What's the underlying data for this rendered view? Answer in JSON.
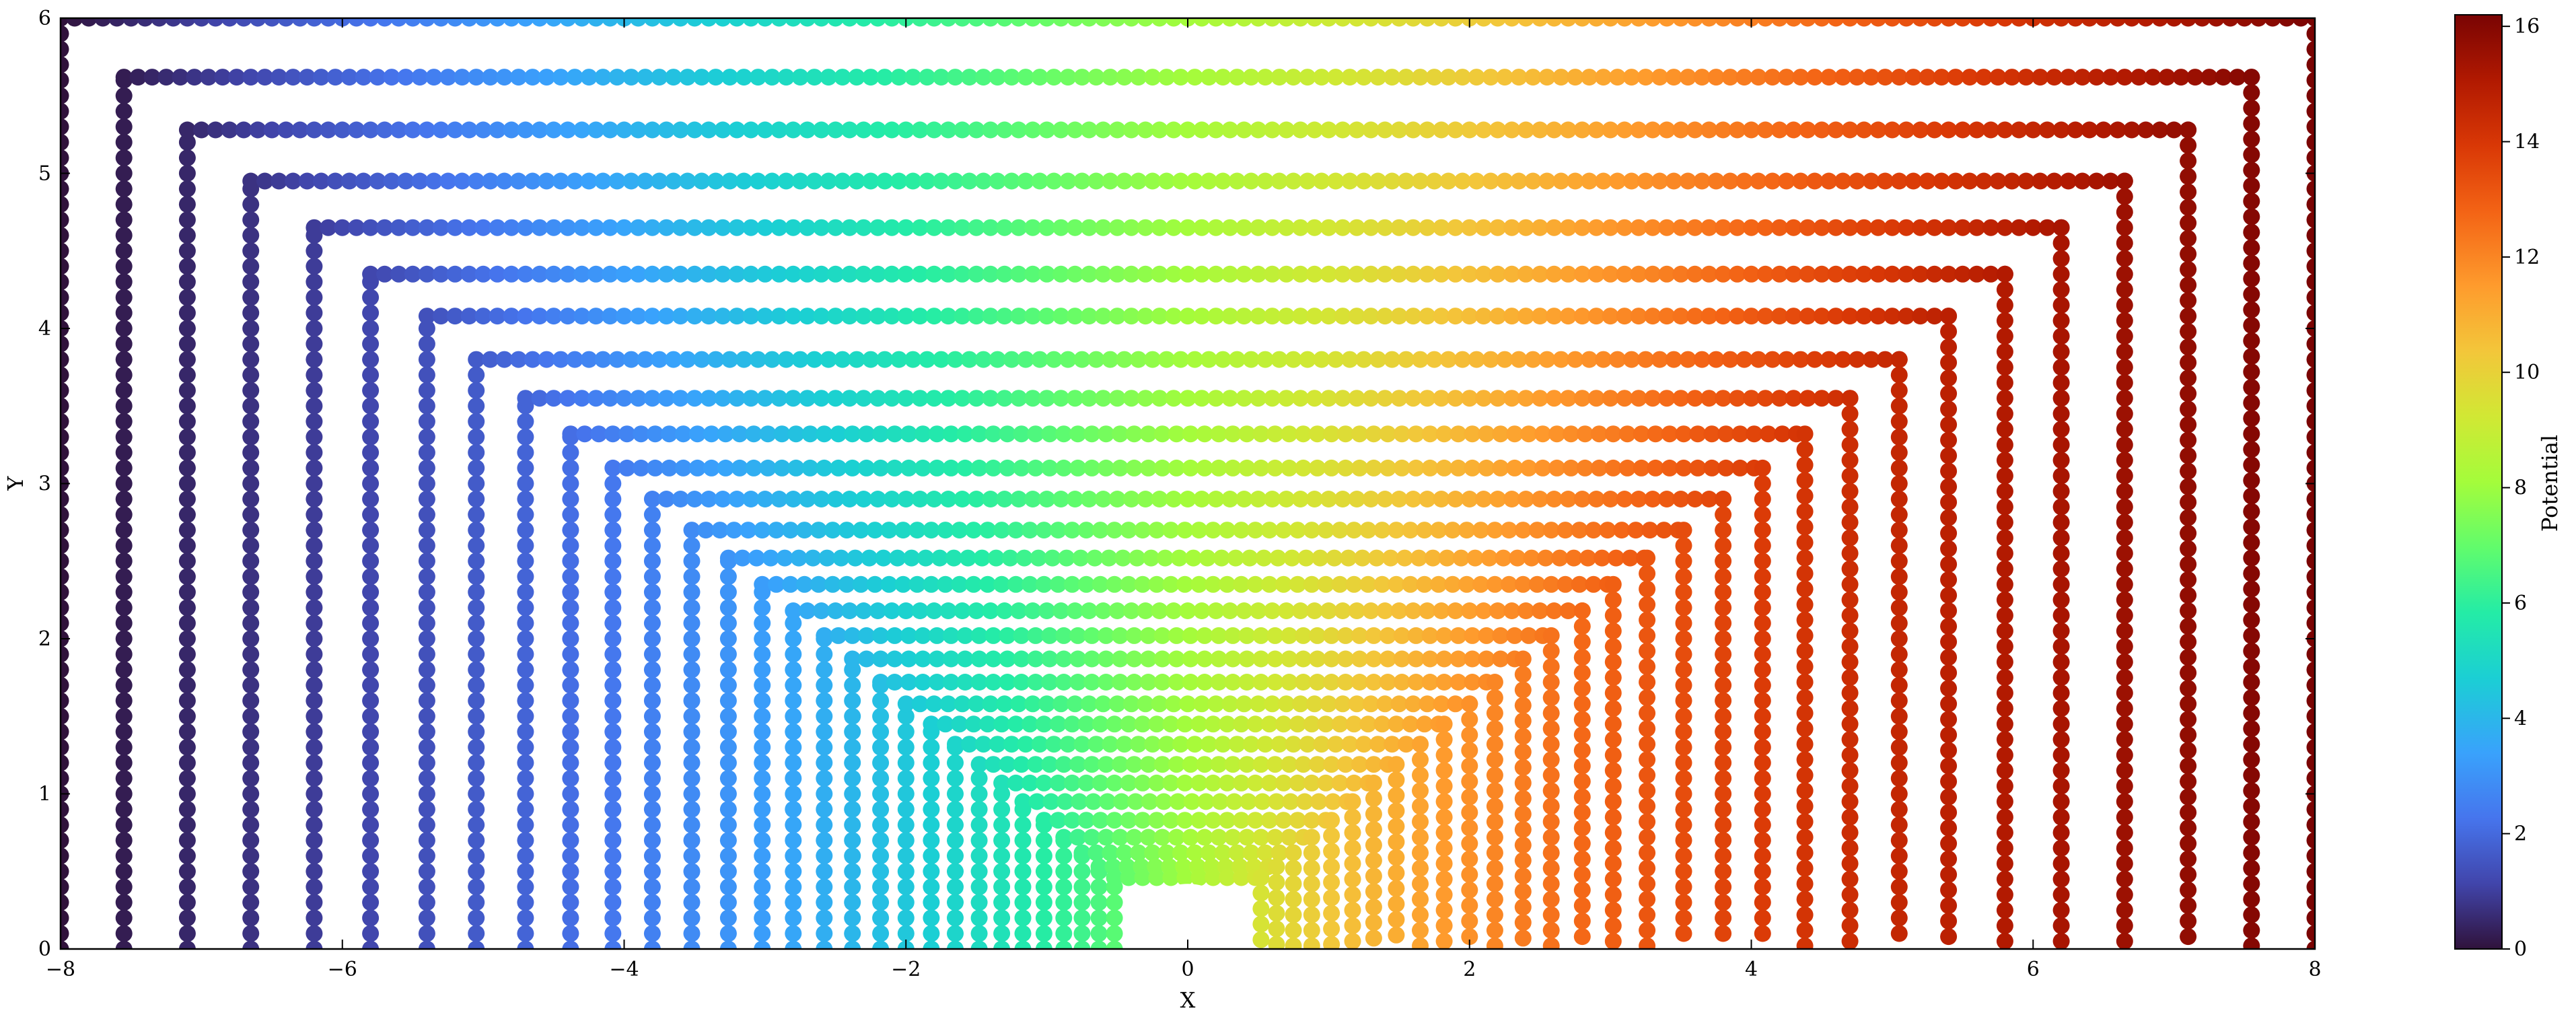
{
  "chart_data": {
    "type": "scatter",
    "title": "",
    "xlabel": "X",
    "ylabel": "Y",
    "xlim": [
      -8,
      8
    ],
    "ylim": [
      0,
      6
    ],
    "x_ticks": [
      -8,
      -6,
      -4,
      -2,
      0,
      2,
      4,
      6,
      8
    ],
    "y_ticks": [
      0,
      1,
      2,
      3,
      4,
      5,
      6
    ],
    "grid": false,
    "colormap": "turbo",
    "colorbar": {
      "label": "Potential",
      "range": [
        0,
        16.2
      ],
      "ticks": [
        0,
        2,
        4,
        6,
        8,
        10,
        12,
        14,
        16
      ]
    },
    "obstacle": {
      "shape": "semicircle",
      "center": [
        0,
        0
      ],
      "radius": 0.42
    },
    "field_points": {
      "description_of_values": "potential at each point ≈ x + 8 rescaled along stream-like contours",
      "series": [
        {
          "half_width": 8.0,
          "height": 6.0
        },
        {
          "half_width": 7.55,
          "height": 5.62
        },
        {
          "half_width": 7.1,
          "height": 5.28
        },
        {
          "half_width": 6.65,
          "height": 4.95
        },
        {
          "half_width": 6.2,
          "height": 4.65
        },
        {
          "half_width": 5.8,
          "height": 4.35
        },
        {
          "half_width": 5.4,
          "height": 4.08
        },
        {
          "half_width": 5.05,
          "height": 3.8
        },
        {
          "half_width": 4.7,
          "height": 3.55
        },
        {
          "half_width": 4.38,
          "height": 3.32
        },
        {
          "half_width": 4.08,
          "height": 3.1
        },
        {
          "half_width": 3.8,
          "height": 2.9
        },
        {
          "half_width": 3.52,
          "height": 2.7
        },
        {
          "half_width": 3.26,
          "height": 2.52
        },
        {
          "half_width": 3.02,
          "height": 2.35
        },
        {
          "half_width": 2.8,
          "height": 2.18
        },
        {
          "half_width": 2.58,
          "height": 2.02
        },
        {
          "half_width": 2.38,
          "height": 1.87
        },
        {
          "half_width": 2.18,
          "height": 1.72
        },
        {
          "half_width": 2.0,
          "height": 1.58
        },
        {
          "half_width": 1.82,
          "height": 1.45
        },
        {
          "half_width": 1.65,
          "height": 1.32
        },
        {
          "half_width": 1.48,
          "height": 1.19
        },
        {
          "half_width": 1.32,
          "height": 1.07
        },
        {
          "half_width": 1.17,
          "height": 0.95
        },
        {
          "half_width": 1.02,
          "height": 0.83
        },
        {
          "half_width": 0.88,
          "height": 0.72
        },
        {
          "half_width": 0.75,
          "height": 0.62
        },
        {
          "half_width": 0.63,
          "height": 0.53
        },
        {
          "half_width": 0.52,
          "height": 0.46
        }
      ]
    }
  }
}
